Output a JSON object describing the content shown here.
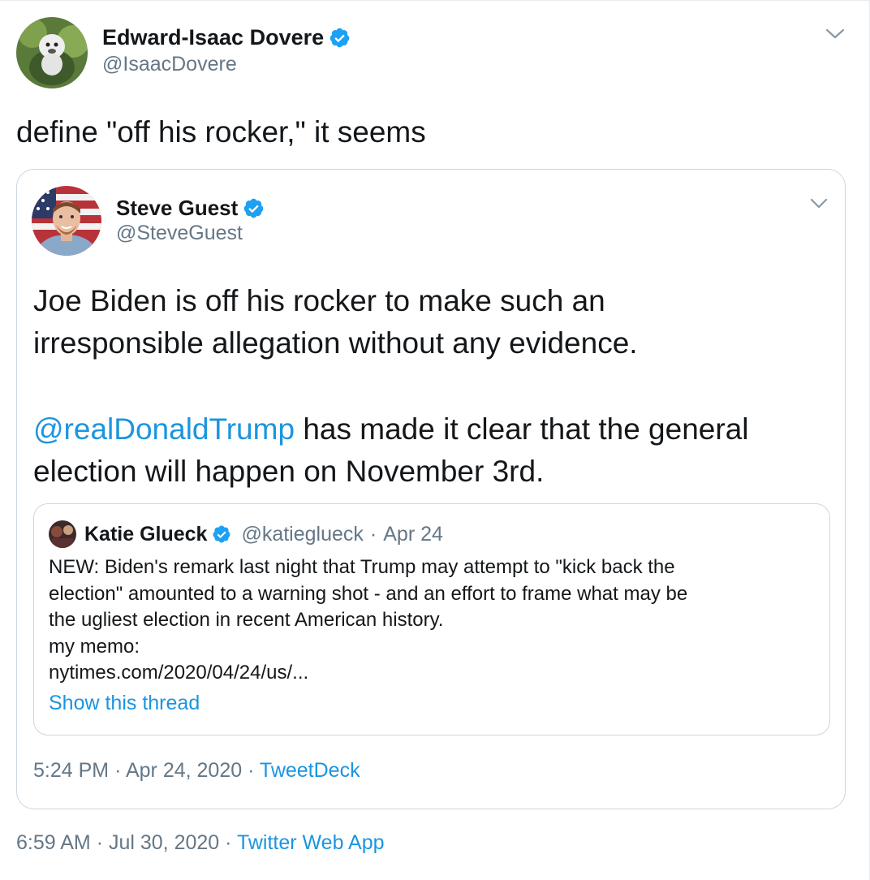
{
  "tweet": {
    "author": {
      "name": "Edward-Isaac Dovere",
      "handle": "@IsaacDovere",
      "verified": true
    },
    "text": "define \"off his rocker,\" it seems",
    "time": "6:59 AM",
    "sep": "·",
    "date": "Jul 30, 2020",
    "source": "Twitter Web App",
    "quoted": {
      "author": {
        "name": "Steve Guest",
        "handle": "@SteveGuest",
        "verified": true
      },
      "text_line1": "Joe Biden is off his rocker to make such an",
      "text_line2": "irresponsible allegation without any evidence.",
      "mention": "@realDonaldTrump",
      "text_line3_rest": " has made it clear that the general",
      "text_line4": "election will happen on November 3rd.",
      "time": "5:24 PM",
      "date": "Apr 24, 2020",
      "source": "TweetDeck",
      "nested": {
        "author": {
          "name": "Katie Glueck",
          "handle": "@katieglueck",
          "date": "Apr 24"
        },
        "lines": [
          "NEW: Biden's remark last night that Trump may attempt to \"kick back the",
          "election\" amounted to a warning shot - and an effort to frame what may be",
          "the ugliest election in recent American history.",
          "my memo:",
          "nytimes.com/2020/04/24/us/..."
        ],
        "show_thread": "Show this thread"
      }
    }
  },
  "colors": {
    "link": "#1b95e0",
    "muted": "#657786",
    "text": "#14171a",
    "border": "#ccd6dd",
    "verified": "#1da1f2"
  },
  "icons": {
    "verified": "verified-badge-icon",
    "more": "chevron-down-icon"
  }
}
